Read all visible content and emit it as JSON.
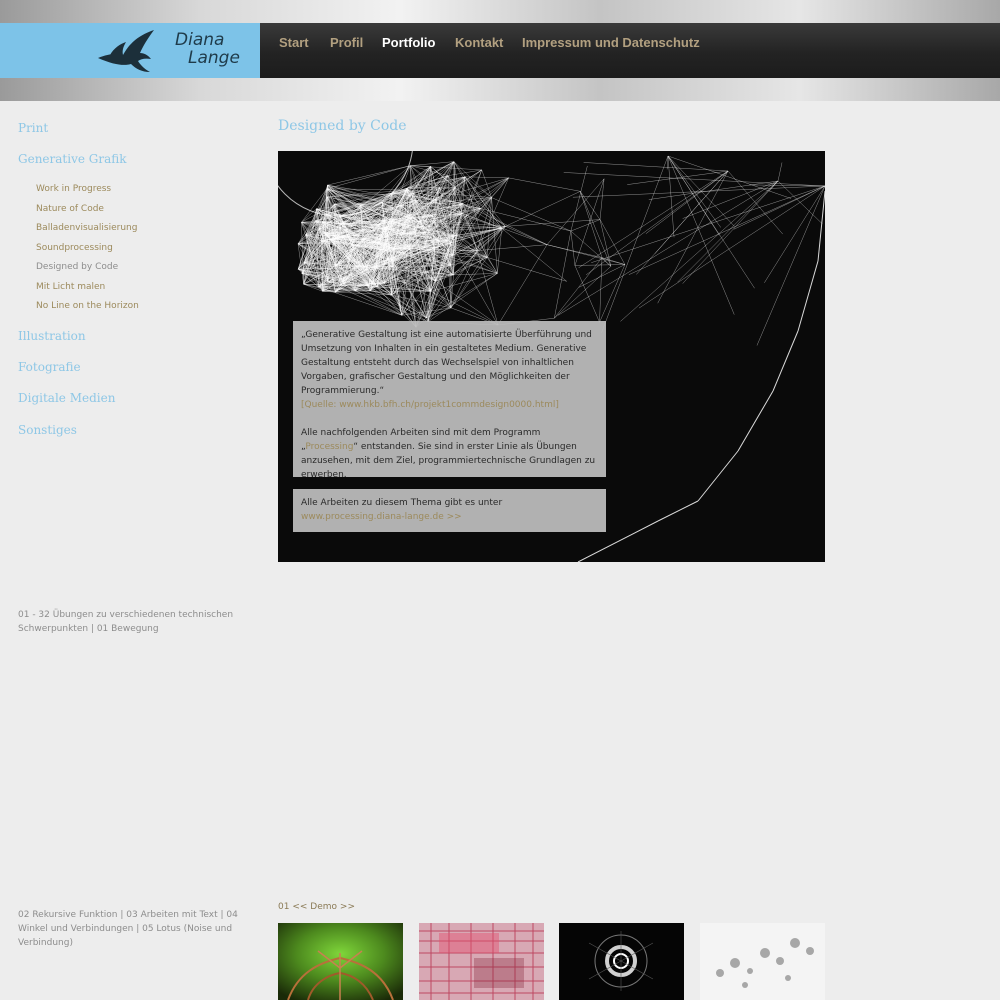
{
  "header": {
    "logo_line1": "Diana",
    "logo_line2": "Lange",
    "brand_color": "#7dc3e8",
    "nav": [
      {
        "label": "Start",
        "active": false
      },
      {
        "label": "Profil",
        "active": false
      },
      {
        "label": "Portfolio",
        "active": true
      },
      {
        "label": "Kontakt",
        "active": false
      },
      {
        "label": "Impressum und Datenschutz",
        "active": false
      }
    ]
  },
  "sidebar": {
    "categories": [
      "Print",
      "Generative Grafik",
      "Illustration",
      "Fotografie",
      "Digitale Medien",
      "Sonstiges"
    ],
    "subitems": [
      "Work in Progress",
      "Nature of Code",
      "Balladenvisualisierung",
      "Soundprocessing",
      "Designed by Code",
      "Mit Licht malen",
      "No Line on the Horizon"
    ],
    "current_subitem": "Designed by Code",
    "note1": "01 - 32 Übungen zu verschiedenen technischen Schwerpunkten | 01 Bewegung",
    "note2": "02 Rekursive Funktion | 03 Arbeiten mit Text | 04 Winkel und Verbindungen | 05 Lotus (Noise und Verbindung)"
  },
  "main": {
    "title": "Designed by Code",
    "quote": "„Generative Gestaltung ist eine automatisierte Überführung und Umsetzung von Inhalten in ein gestaltetes Medium. Generative Gestaltung entsteht durch das Wechselspiel von inhaltlichen Vorgaben, grafischer Gestaltung und den Möglichkeiten der Programmierung.“",
    "source": "[Quelle: www.hkb.bfh.ch/projekt1commdesign0000.html]",
    "intro_before": "Alle nachfolgenden Arbeiten sind mit dem Programm „",
    "intro_link": "Processing",
    "intro_after": "“ entstanden. Sie sind in erster Linie als Übungen anzusehen, mit dem Ziel, programmiertechnische Grundlagen zu erwerben.",
    "all_works_text": "Alle Arbeiten zu diesem Thema gibt es unter",
    "all_works_link": "www.processing.diana-lange.de >>"
  },
  "demo": {
    "number": "01",
    "prev": "<<",
    "label": "Demo",
    "next": ">>"
  },
  "colors": {
    "accent_blue": "#8ec7e6",
    "link_gold": "#9c8a5c",
    "nav_text": "#b2a080"
  }
}
